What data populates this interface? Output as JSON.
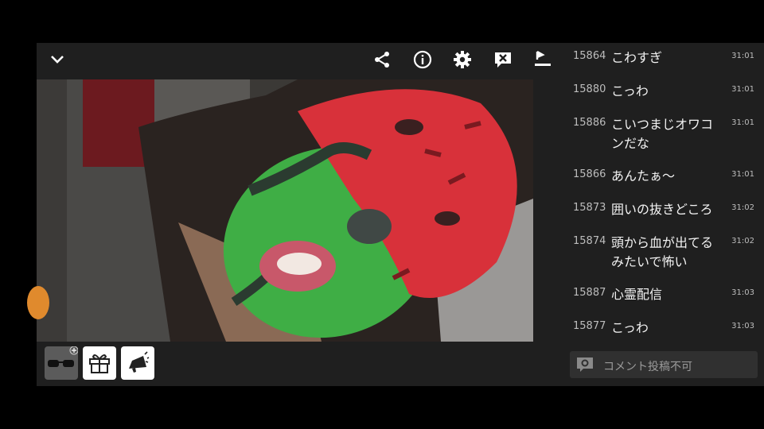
{
  "comments": [
    {
      "id": "15864",
      "text": "こわすぎ",
      "time": "31:01"
    },
    {
      "id": "15880",
      "text": "こっわ",
      "time": "31:01"
    },
    {
      "id": "15886",
      "text": "こいつまじオワコンだな",
      "time": "31:01"
    },
    {
      "id": "15866",
      "text": "あんたぁ～",
      "time": "31:01"
    },
    {
      "id": "15873",
      "text": "囲いの抜きどころ",
      "time": "31:02"
    },
    {
      "id": "15874",
      "text": "頭から血が出てるみたいで怖い",
      "time": "31:02"
    },
    {
      "id": "15887",
      "text": "心霊配信",
      "time": "31:03"
    },
    {
      "id": "15877",
      "text": "こっわ",
      "time": "31:03"
    }
  ],
  "comment_input": {
    "label": "コメント投稿不可"
  },
  "icons": {
    "collapse": "chevron-down-icon",
    "share": "share-icon",
    "info": "info-icon",
    "settings": "gear-icon",
    "close_comments": "comment-off-icon",
    "upload": "upload-icon",
    "glasses": "glasses-icon",
    "gift": "gift-icon",
    "megaphone": "megaphone-icon"
  },
  "colors": {
    "background": "#1f1f1f",
    "face_green": "#3fae45",
    "face_red": "#d8313a",
    "accent_orange": "#e08a2d"
  }
}
